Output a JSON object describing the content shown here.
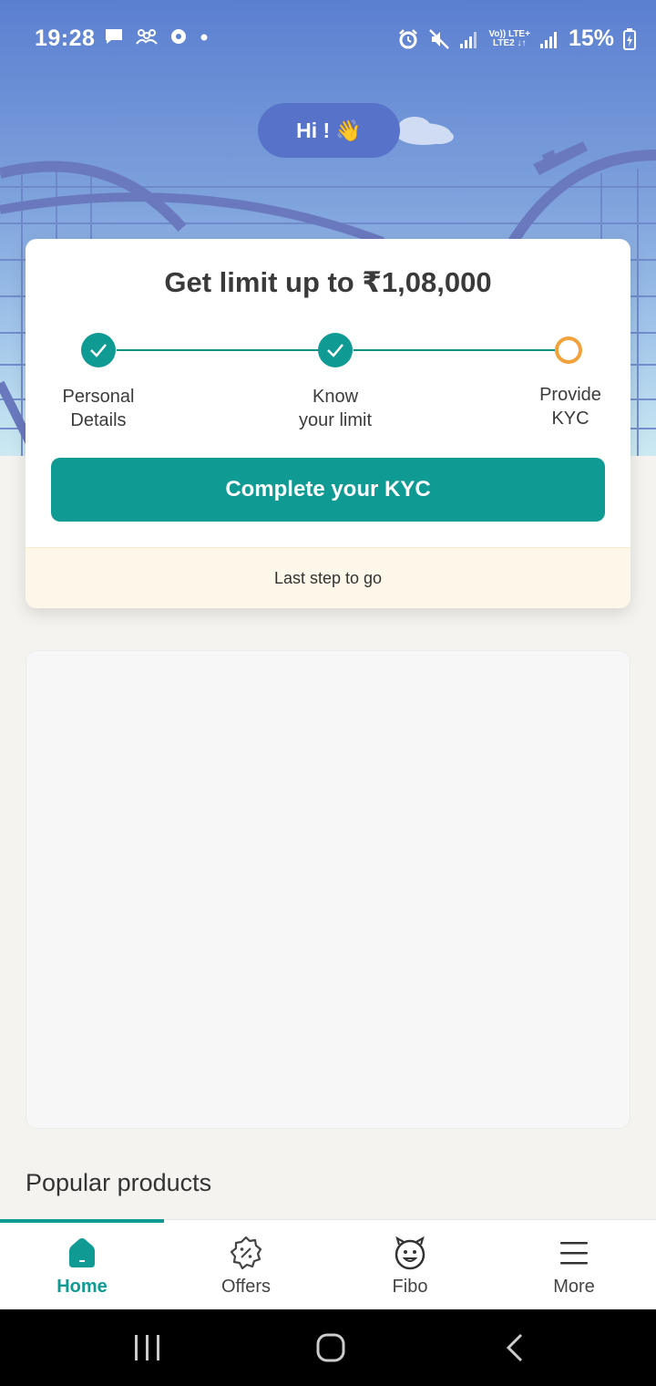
{
  "status_bar": {
    "time": "19:28",
    "battery_percent": "15%",
    "network_top": "Vo)) LTE+",
    "network_bottom": "LTE2 ↓↑"
  },
  "greeting": {
    "text": "Hi !",
    "emoji": "👋"
  },
  "limit_card": {
    "title": "Get limit up to ₹1,08,000",
    "steps": [
      {
        "label_line1": "Personal",
        "label_line2": "Details",
        "status": "done"
      },
      {
        "label_line1": "Know",
        "label_line2": "your limit",
        "status": "done"
      },
      {
        "label_line1": "Provide",
        "label_line2": "KYC",
        "status": "pending"
      }
    ],
    "cta_label": "Complete your KYC",
    "footer_text": "Last step to go",
    "accent": "#0f9a94",
    "pending_color": "#f2a23c"
  },
  "section": {
    "popular_title": "Popular products"
  },
  "bottom_nav": {
    "items": [
      {
        "label": "Home",
        "icon": "home-icon",
        "active": true
      },
      {
        "label": "Offers",
        "icon": "offers-badge-icon",
        "active": false
      },
      {
        "label": "Fibo",
        "icon": "fibo-mascot-icon",
        "active": false
      },
      {
        "label": "More",
        "icon": "menu-icon",
        "active": false
      }
    ]
  }
}
